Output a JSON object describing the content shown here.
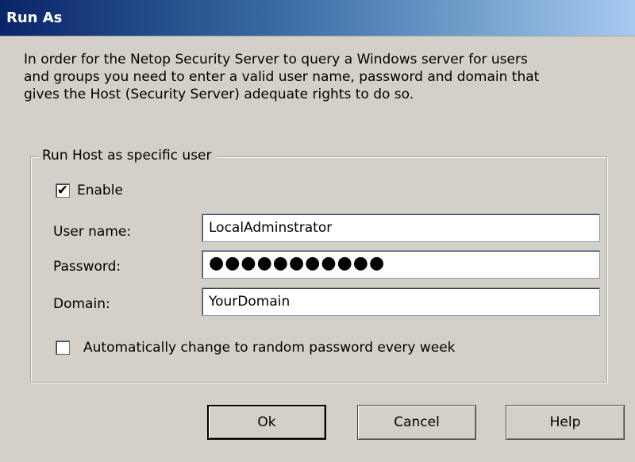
{
  "window": {
    "title": "Run As"
  },
  "intro": {
    "text": "In order for the Netop Security Server to query a Windows server for users\nand groups you need to enter a valid user name, password and domain that\ngives the Host (Security Server) adequate rights to do so."
  },
  "group": {
    "legend": "Run Host as specific user",
    "enable": {
      "label": "Enable",
      "checked": true,
      "mark": "✔"
    },
    "username": {
      "label": "User name:",
      "value": "LocalAdminstrator"
    },
    "password": {
      "label": "Password:",
      "masked_value": "●●●●●●●●●●●"
    },
    "domain": {
      "label": "Domain:",
      "value": "YourDomain"
    },
    "auto_change": {
      "label": "Automatically change to random password every week",
      "checked": false
    }
  },
  "buttons": {
    "ok": "Ok",
    "cancel": "Cancel",
    "help": "Help"
  }
}
